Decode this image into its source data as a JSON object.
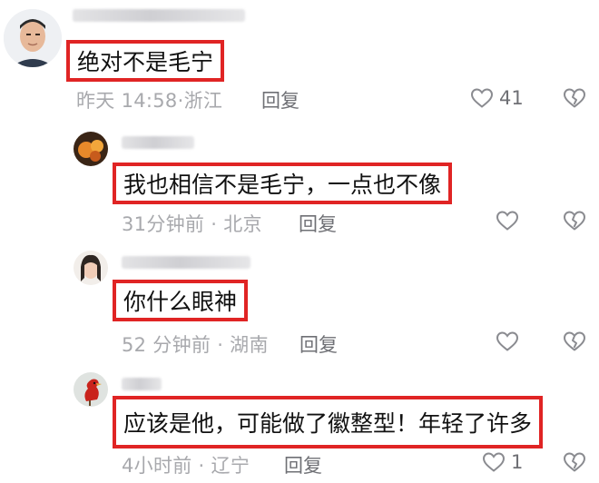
{
  "comments": [
    {
      "text": "绝对不是毛宁",
      "time": "昨天 14:58",
      "location": "浙江",
      "reply_label": "回复",
      "likes": "41"
    },
    {
      "text": "我也相信不是毛宁，一点也不像",
      "time": "31分钟前",
      "location": "北京",
      "reply_label": "回复",
      "likes": ""
    },
    {
      "text": "你什么眼神",
      "time": "52 分钟前",
      "location": "湖南",
      "reply_label": "回复",
      "likes": ""
    },
    {
      "text": "应该是他，可能做了徽整型！年轻了许多",
      "time": "4小时前",
      "location": "辽宁",
      "reply_label": "回复",
      "likes": "1"
    }
  ],
  "meta_separator": "·",
  "colors": {
    "highlight_box": "#e02424",
    "meta_text": "#a8a9ad",
    "reply_text": "#6f7075"
  },
  "icons": {
    "like": "heart-outline-icon",
    "dislike": "broken-heart-icon"
  }
}
